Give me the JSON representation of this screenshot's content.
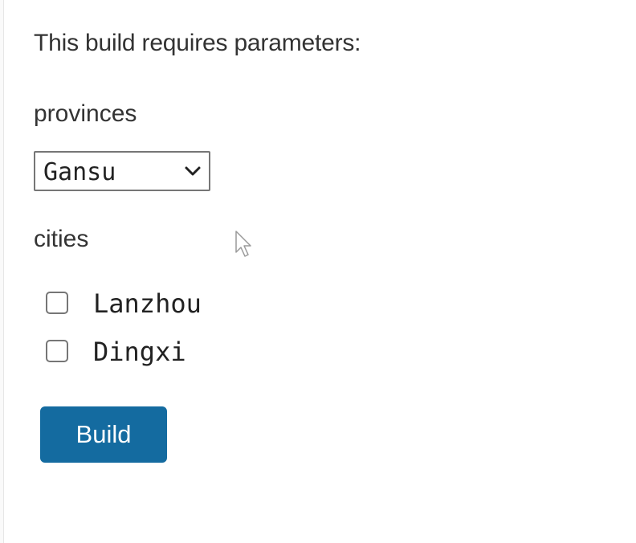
{
  "form": {
    "intro_text": "This build requires parameters:",
    "provinces": {
      "label": "provinces",
      "selected_value": "Gansu"
    },
    "cities": {
      "label": "cities",
      "options": [
        {
          "label": "Lanzhou",
          "checked": false
        },
        {
          "label": "Dingxi",
          "checked": false
        }
      ]
    },
    "build_button_label": "Build"
  },
  "colors": {
    "button_background": "#146ba0",
    "button_text": "#ffffff",
    "text": "#333333",
    "control_border": "#767676"
  },
  "icons": {
    "select_arrow": "chevron-down-icon",
    "pointer": "mouse-cursor-icon"
  }
}
